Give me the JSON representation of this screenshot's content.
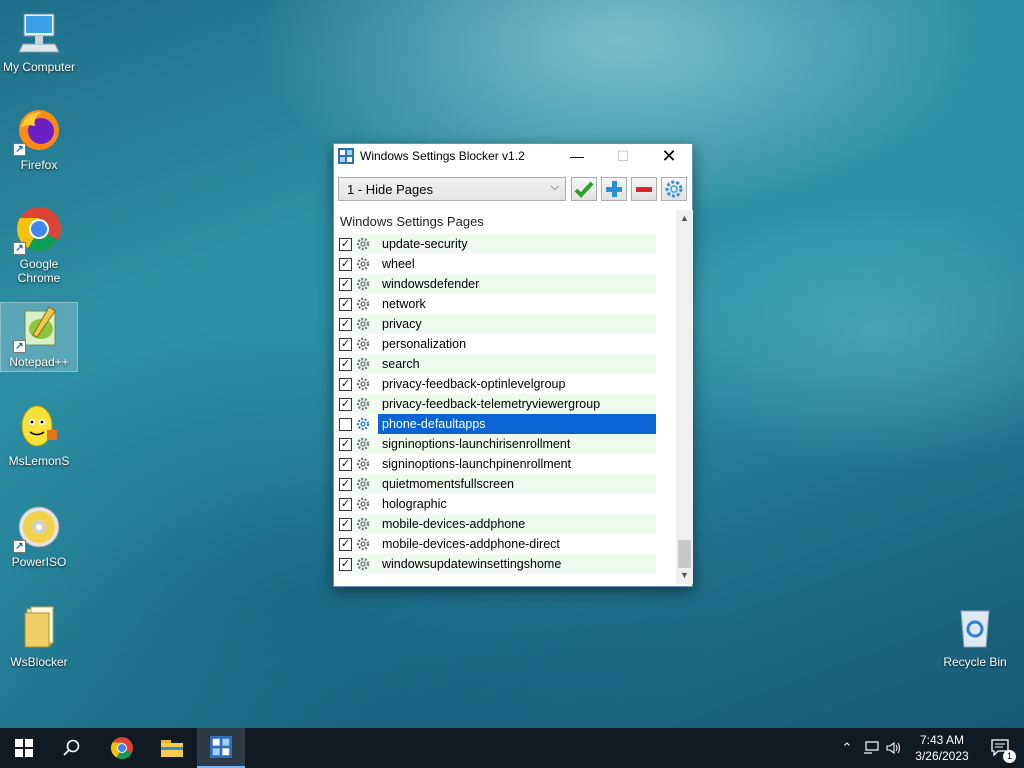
{
  "desktop": {
    "icons": [
      {
        "label": "My Computer"
      },
      {
        "label": "Firefox"
      },
      {
        "label": "Google Chrome"
      },
      {
        "label": "Notepad++"
      },
      {
        "label": "MsLemonS"
      },
      {
        "label": "PowerISO"
      },
      {
        "label": "WsBlocker"
      },
      {
        "label": "Recycle Bin"
      }
    ]
  },
  "window": {
    "title": "Windows Settings Blocker v1.2",
    "mode_select": "1 - Hide Pages",
    "list_header": "Windows Settings Pages",
    "items": [
      {
        "label": "update-security",
        "checked": true
      },
      {
        "label": "wheel",
        "checked": true
      },
      {
        "label": "windowsdefender",
        "checked": true
      },
      {
        "label": "network",
        "checked": true
      },
      {
        "label": "privacy",
        "checked": true
      },
      {
        "label": "personalization",
        "checked": true
      },
      {
        "label": "search",
        "checked": true
      },
      {
        "label": "privacy-feedback-optinlevelgroup",
        "checked": true
      },
      {
        "label": "privacy-feedback-telemetryviewergroup",
        "checked": true
      },
      {
        "label": "phone-defaultapps",
        "checked": false,
        "selected": true
      },
      {
        "label": "signinoptions-launchirisenrollment",
        "checked": true
      },
      {
        "label": "signinoptions-launchpinenrollment",
        "checked": true
      },
      {
        "label": "quietmomentsfullscreen",
        "checked": true
      },
      {
        "label": "holographic",
        "checked": true
      },
      {
        "label": "mobile-devices-addphone",
        "checked": true
      },
      {
        "label": "mobile-devices-addphone-direct",
        "checked": true
      },
      {
        "label": "windowsupdatewinsettingshome",
        "checked": true
      }
    ]
  },
  "taskbar": {
    "time": "7:43 AM",
    "date": "3/26/2023",
    "notification_count": "1"
  },
  "colors": {
    "selection": "#0a64d4",
    "row_alt": "#f0fbf0",
    "taskbar": "#101a22"
  }
}
